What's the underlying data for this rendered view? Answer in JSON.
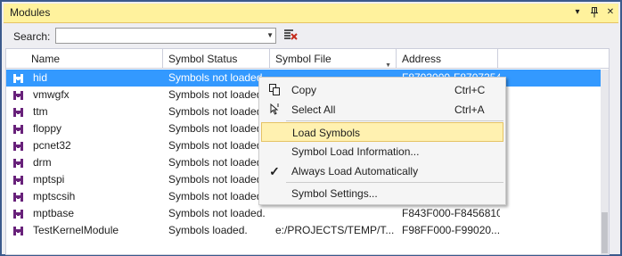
{
  "panel": {
    "title": "Modules"
  },
  "search": {
    "label": "Search:",
    "value": "",
    "placeholder": ""
  },
  "columns": {
    "name": "Name",
    "status": "Symbol Status",
    "file": "Symbol File",
    "address": "Address"
  },
  "rows": [
    {
      "name": "hid",
      "status": "Symbols not loaded.",
      "file": "",
      "address": "F8703000-F8707354",
      "selected": true
    },
    {
      "name": "vmwgfx",
      "status": "Symbols not loaded.",
      "file": "",
      "address": ""
    },
    {
      "name": "ttm",
      "status": "Symbols not loaded.",
      "file": "",
      "address": ""
    },
    {
      "name": "floppy",
      "status": "Symbols not loaded.",
      "file": "",
      "address": ""
    },
    {
      "name": "pcnet32",
      "status": "Symbols not loaded.",
      "file": "",
      "address": ""
    },
    {
      "name": "drm",
      "status": "Symbols not loaded.",
      "file": "",
      "address": ""
    },
    {
      "name": "mptspi",
      "status": "Symbols not loaded.",
      "file": "",
      "address": ""
    },
    {
      "name": "mptscsih",
      "status": "Symbols not loaded.",
      "file": "",
      "address": ""
    },
    {
      "name": "mptbase",
      "status": "Symbols not loaded.",
      "file": "",
      "address": "F843F000-F8456810"
    },
    {
      "name": "TestKernelModule",
      "status": "Symbols loaded.",
      "file": "e:/PROJECTS/TEMP/T...",
      "address": "F98FF000-F99020..."
    }
  ],
  "menu": {
    "copy": {
      "label": "Copy",
      "shortcut": "Ctrl+C"
    },
    "select_all": {
      "label": "Select All",
      "shortcut": "Ctrl+A"
    },
    "load_symbols": {
      "label": "Load Symbols"
    },
    "symbol_load_info": {
      "label": "Symbol Load Information..."
    },
    "always_load": {
      "label": "Always Load Automatically",
      "checked": true
    },
    "symbol_settings": {
      "label": "Symbol Settings..."
    }
  },
  "icons": {
    "module": "module-icon",
    "copy": "copy-icon",
    "select_all": "select-all-icon",
    "check": "check-icon",
    "clear_search": "clear-search-icon",
    "pin": "pin-icon",
    "close": "close-icon",
    "dropdown": "dropdown-arrow-icon"
  },
  "colors": {
    "title_bg": "#fff29d",
    "selection": "#3399ff",
    "menu_highlight": "#fff1b0",
    "module_icon": "#68217a",
    "clear_icon": "#c42b1c"
  }
}
